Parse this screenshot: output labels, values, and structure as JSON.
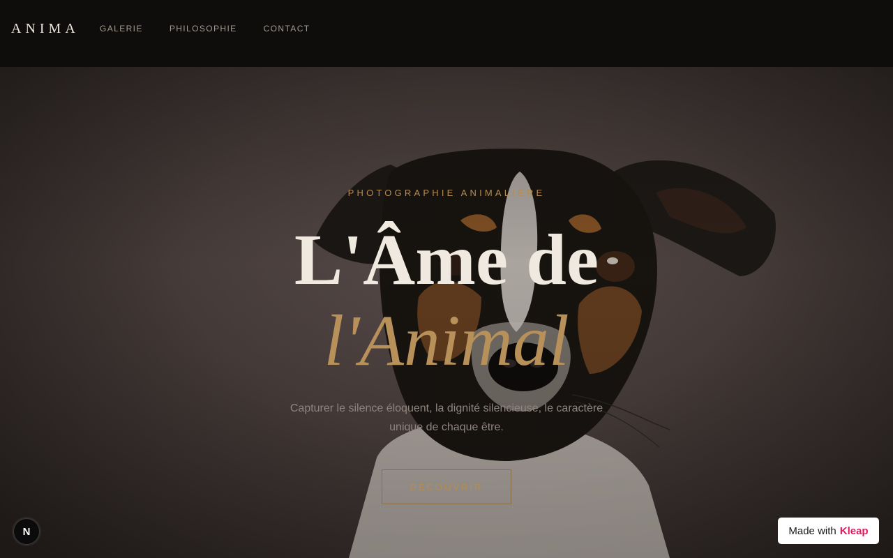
{
  "header": {
    "logo": "ANIMA",
    "nav": [
      {
        "label": "GALERIE"
      },
      {
        "label": "PHILOSOPHIE"
      },
      {
        "label": "CONTACT"
      }
    ]
  },
  "hero": {
    "eyebrow": "PHOTOGRAPHIE ANIMALIÈRE",
    "title_line1": "L'Âme de",
    "title_line2": "l'Animal",
    "subtitle": "Capturer le silence éloquent, la dignité silencieuse, le caractère unique de chaque être.",
    "cta_label": "DÉCOUVRIR",
    "image_subject": "dog-portrait"
  },
  "badges": {
    "n_badge": "N",
    "made_with_prefix": "Made with",
    "made_with_brand": "Kleap"
  },
  "colors": {
    "accent": "#b8915a",
    "background": "#0e0d0c",
    "brand": "#e2165e"
  }
}
